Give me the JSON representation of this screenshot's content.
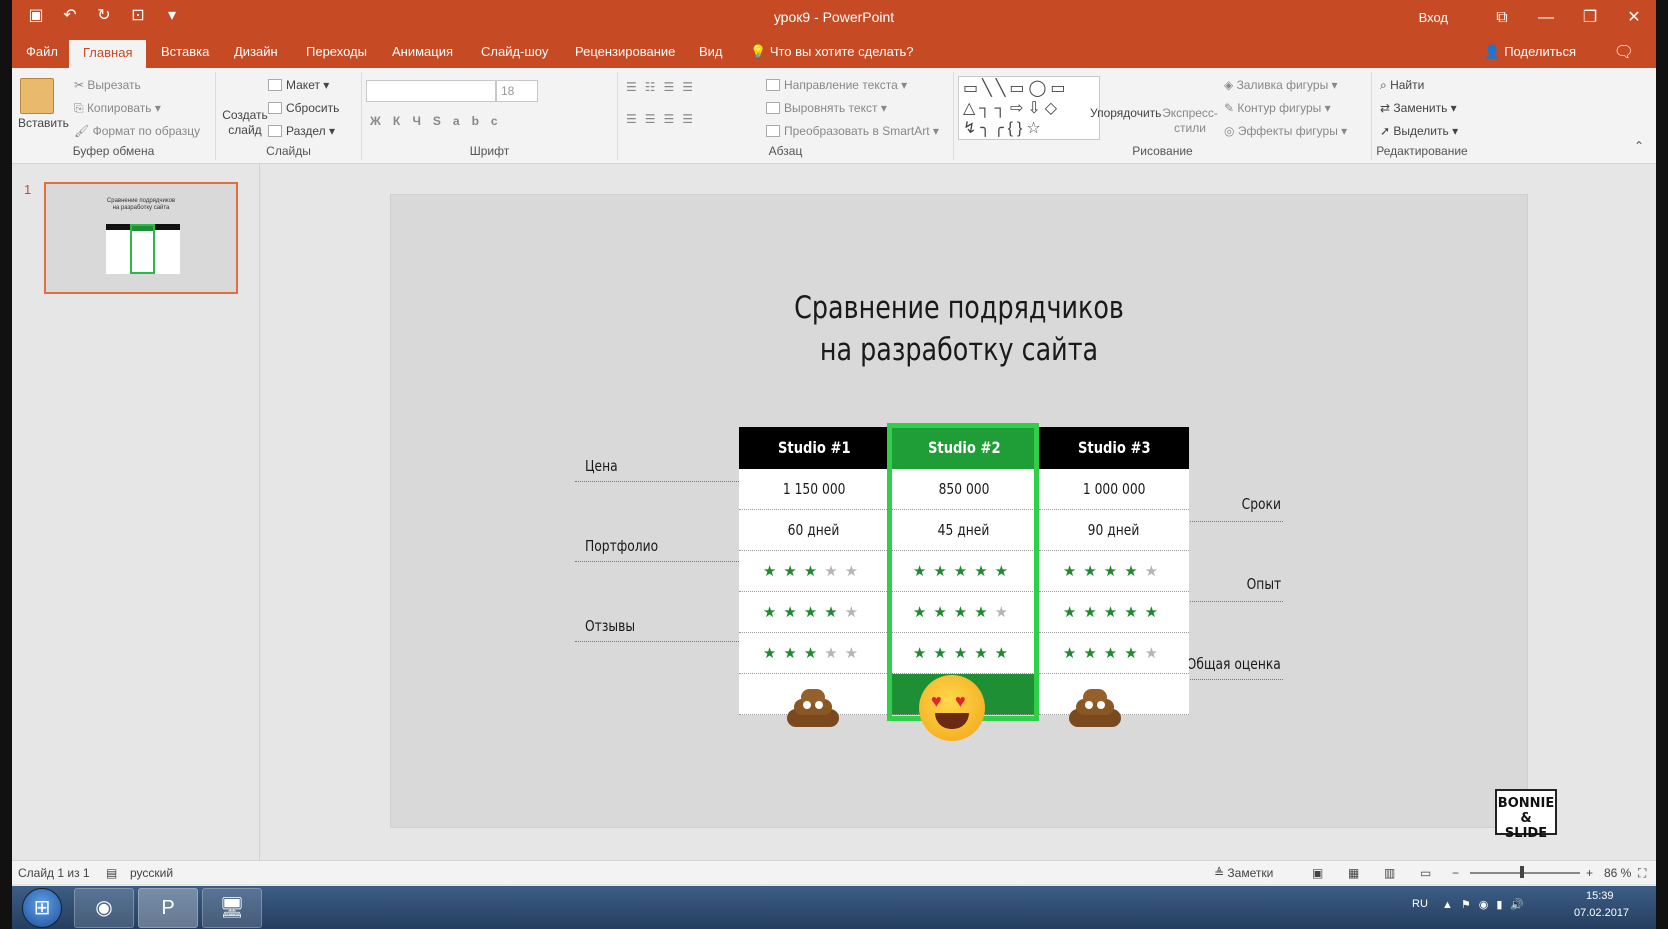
{
  "window": {
    "title": "урок9 - PowerPoint",
    "signin": "Вход"
  },
  "tabs": [
    "Файл",
    "Главная",
    "Вставка",
    "Дизайн",
    "Переходы",
    "Анимация",
    "Слайд-шоу",
    "Рецензирование",
    "Вид"
  ],
  "tell_me": "Что вы хотите сделать?",
  "share": "Поделиться",
  "ribbon": {
    "clipboard": {
      "paste": "Вставить",
      "cut": "Вырезать",
      "copy": "Копировать",
      "format_painter": "Формат по образцу",
      "group": "Буфер обмена"
    },
    "slides": {
      "new_slide": "Создать слайд",
      "layout": "Макет",
      "reset": "Сбросить",
      "section": "Раздел",
      "group": "Слайды"
    },
    "font": {
      "size": "18",
      "group": "Шрифт"
    },
    "paragraph": {
      "text_direction": "Направление текста",
      "align_text": "Выровнять текст",
      "smartart": "Преобразовать в SmartArt",
      "group": "Абзац"
    },
    "drawing": {
      "arrange": "Упорядочить",
      "quick_styles": "Экспресс-стили",
      "fill": "Заливка фигуры",
      "outline": "Контур фигуры",
      "effects": "Эффекты фигуры",
      "group": "Рисование"
    },
    "editing": {
      "find": "Найти",
      "replace": "Заменить",
      "select": "Выделить",
      "group": "Редактирование"
    }
  },
  "thumbnail": {
    "number": "1"
  },
  "slide": {
    "title_line1": "Сравнение подрядчиков",
    "title_line2": "на разработку сайта",
    "studios": [
      "Studio #1",
      "Studio #2",
      "Studio #3"
    ],
    "prices": [
      "1 150 000",
      "850 000",
      "1 000 000"
    ],
    "terms": [
      "60 дней",
      "45 дней",
      "90 дней"
    ],
    "portfolio_stars": [
      3,
      5,
      4
    ],
    "experience_stars": [
      4,
      4,
      5
    ],
    "reviews_stars": [
      3,
      5,
      4
    ],
    "overall": [
      "poop-emoji",
      "heart-eyes-emoji",
      "poop-emoji"
    ],
    "winner_index": 1,
    "labels_left": {
      "price": "Цена",
      "portfolio": "Портфолио",
      "reviews": "Отзывы"
    },
    "labels_right": {
      "terms": "Сроки",
      "experience": "Опыт",
      "overall": "Общая оценка"
    },
    "logo_line1": "BONNIE",
    "logo_line2": "& SLIDE"
  },
  "statusbar": {
    "slide_info": "Слайд 1 из 1",
    "language": "русский",
    "notes": "Заметки",
    "zoom": "86 %"
  },
  "taskbar": {
    "lang": "RU",
    "time": "15:39",
    "date": "07.02.2017"
  },
  "colors": {
    "accent": "#c64a24",
    "winner_green": "#2fd048",
    "star_green": "#1d8a2f"
  }
}
